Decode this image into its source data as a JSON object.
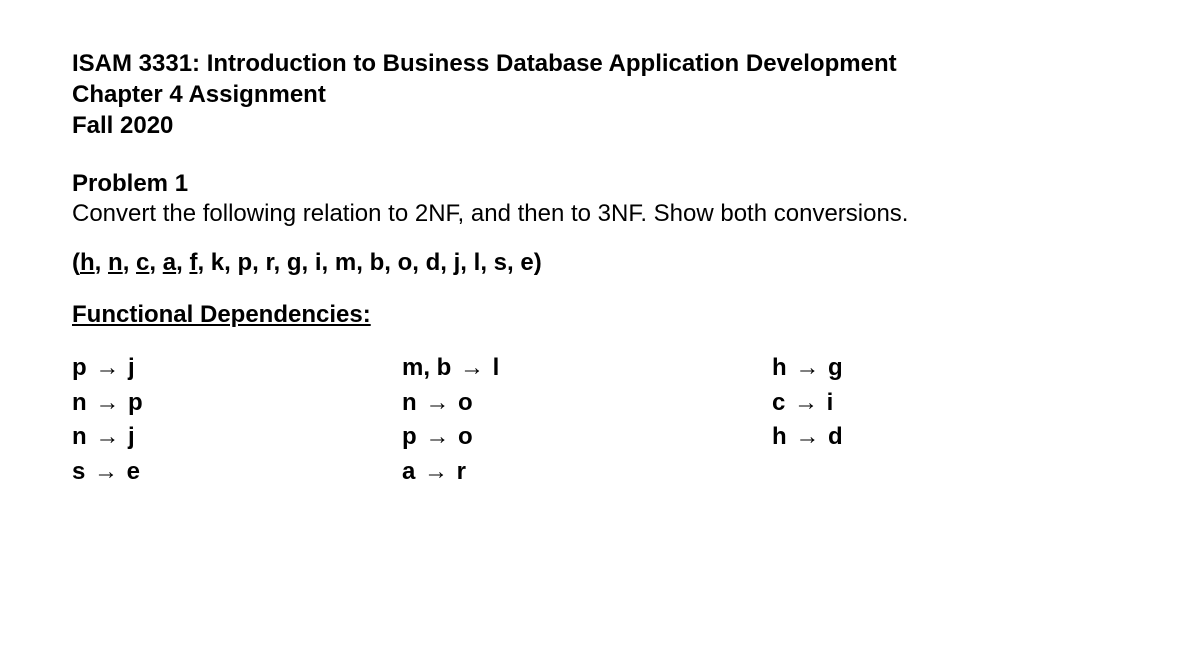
{
  "header": {
    "course_line": "ISAM 3331: Introduction to Business Database Application Development",
    "chapter_line": "Chapter 4 Assignment",
    "term_line": "Fall 2020"
  },
  "problem": {
    "title": "Problem 1",
    "description": "Convert the following relation to 2NF, and then to 3NF. Show both conversions."
  },
  "relation": {
    "open": "(",
    "close": ")",
    "sep": ", ",
    "key_attrs": [
      "h",
      "n",
      "c",
      "a",
      "f"
    ],
    "nonkey_attrs": [
      "k",
      "p",
      "r",
      "g",
      "i",
      "m",
      "b",
      "o",
      "d",
      "j",
      "l",
      "s",
      "e"
    ]
  },
  "fd": {
    "header": "Functional Dependencies:",
    "arrow": "→",
    "columns": [
      [
        {
          "lhs": "p",
          "rhs": "j"
        },
        {
          "lhs": "n",
          "rhs": "p"
        },
        {
          "lhs": "n",
          "rhs": "j"
        },
        {
          "lhs": "s",
          "rhs": "e"
        }
      ],
      [
        {
          "lhs": "m, b",
          "rhs": "l"
        },
        {
          "lhs": "n",
          "rhs": "o"
        },
        {
          "lhs": "p",
          "rhs": "o"
        },
        {
          "lhs": "a",
          "rhs": "r"
        }
      ],
      [
        {
          "lhs": "h",
          "rhs": "g"
        },
        {
          "lhs": "c",
          "rhs": "i"
        },
        {
          "lhs": "h",
          "rhs": "d"
        }
      ]
    ]
  }
}
